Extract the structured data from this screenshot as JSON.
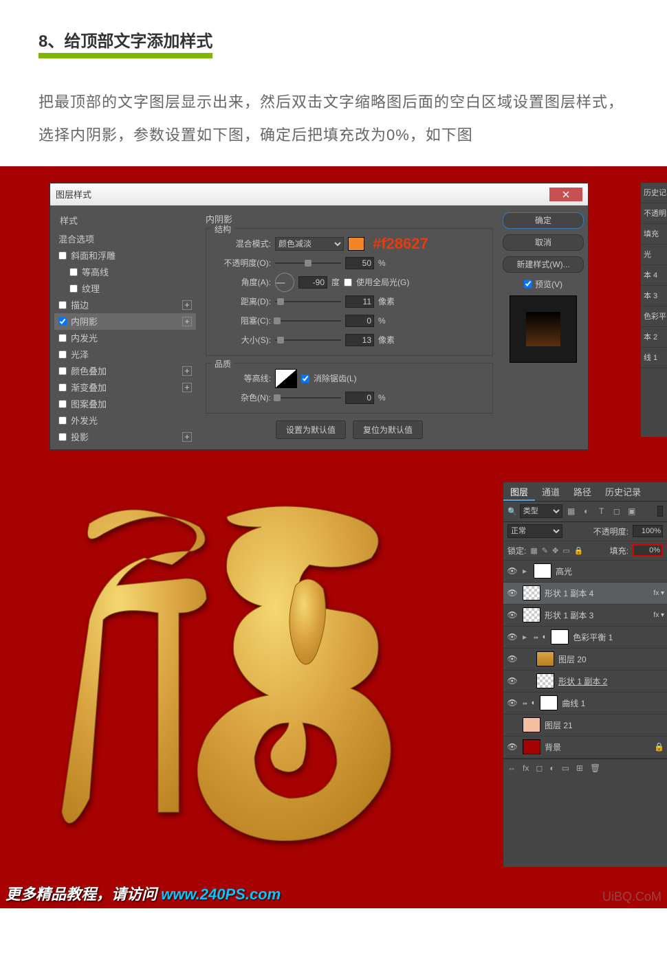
{
  "header": {
    "step_title": "8、给顶部文字添加样式",
    "description": "把最顶部的文字图层显示出来，然后双击文字缩略图后面的空白区域设置图层样式，选择内阴影，参数设置如下图，确定后把填充改为0%，如下图"
  },
  "dialog": {
    "title": "图层样式",
    "close_label": "×",
    "styles_header": "样式",
    "blend_options": "混合选项",
    "items": [
      {
        "label": "斜面和浮雕",
        "checked": false,
        "plus": false
      },
      {
        "label": "等高线",
        "checked": false,
        "plus": false,
        "indent": true
      },
      {
        "label": "纹理",
        "checked": false,
        "plus": false,
        "indent": true
      },
      {
        "label": "描边",
        "checked": false,
        "plus": true
      },
      {
        "label": "内阴影",
        "checked": true,
        "plus": true,
        "selected": true
      },
      {
        "label": "内发光",
        "checked": false,
        "plus": false
      },
      {
        "label": "光泽",
        "checked": false,
        "plus": false
      },
      {
        "label": "颜色叠加",
        "checked": false,
        "plus": true
      },
      {
        "label": "渐变叠加",
        "checked": false,
        "plus": true
      },
      {
        "label": "图案叠加",
        "checked": false,
        "plus": false
      },
      {
        "label": "外发光",
        "checked": false,
        "plus": false
      },
      {
        "label": "投影",
        "checked": false,
        "plus": true
      }
    ],
    "panel_title": "内阴影",
    "structure_label": "结构",
    "blend_mode_label": "混合模式:",
    "blend_mode_value": "颜色减淡",
    "color_hex": "#f28627",
    "opacity_label": "不透明度(O):",
    "opacity_value": "50",
    "opacity_unit": "%",
    "angle_label": "角度(A):",
    "angle_value": "-90",
    "angle_unit": "度",
    "global_light_label": "使用全局光(G)",
    "distance_label": "距离(D):",
    "distance_value": "11",
    "distance_unit": "像素",
    "choke_label": "阻塞(C):",
    "choke_value": "0",
    "choke_unit": "%",
    "size_label": "大小(S):",
    "size_value": "13",
    "size_unit": "像素",
    "quality_label": "品质",
    "contour_label": "等高线:",
    "antialias_label": "消除锯齿(L)",
    "noise_label": "杂色(N):",
    "noise_value": "0",
    "noise_unit": "%",
    "default_btn": "设置为默认值",
    "reset_btn": "复位为默认值",
    "ok_btn": "确定",
    "cancel_btn": "取消",
    "new_style_btn": "新建样式(W)...",
    "preview_label": "预览(V)"
  },
  "hist": {
    "title": "历史记",
    "items": [
      "不透明",
      "填充",
      "光",
      "本 4",
      "本 3",
      "色彩平",
      "本 2",
      "线 1"
    ]
  },
  "layers": {
    "tabs": [
      "图层",
      "通道",
      "路径",
      "历史记录"
    ],
    "filter_label": "类型",
    "blend_mode": "正常",
    "opacity_label": "不透明度:",
    "opacity_value": "100%",
    "lock_label": "锁定:",
    "fill_label": "填充:",
    "fill_value": "0%",
    "items": [
      {
        "name": "高光",
        "eye": true,
        "caret": true,
        "thumb": "white"
      },
      {
        "name": "形状 1 副本 4",
        "eye": true,
        "fx": "fx ▾",
        "selected": true,
        "thumb": "checker"
      },
      {
        "name": "形状 1 副本 3",
        "eye": true,
        "fx": "fx ▾",
        "thumb": "checker"
      },
      {
        "name": "色彩平衡 1",
        "eye": true,
        "caret": true,
        "link": "⇔",
        "thumb": "white",
        "adjlayer": true
      },
      {
        "name": "图层 20",
        "eye": true,
        "thumb": "gold",
        "indent": true
      },
      {
        "name": "形状 1 副本 2",
        "eye": true,
        "thumb": "checker",
        "indent": true,
        "underline": true
      },
      {
        "name": "曲线 1",
        "eye": true,
        "link": "⇔",
        "thumb": "white",
        "adjlayer": true
      },
      {
        "name": "图层 21",
        "eye": false,
        "thumb": "pink"
      },
      {
        "name": "背景",
        "eye": true,
        "thumb": "red",
        "lock": true
      }
    ],
    "bottom_fx": "fx"
  },
  "watermark": {
    "prefix": "更多精品教程，请访问 ",
    "url": "www.240PS.com",
    "right": "UiBQ.CoM"
  }
}
